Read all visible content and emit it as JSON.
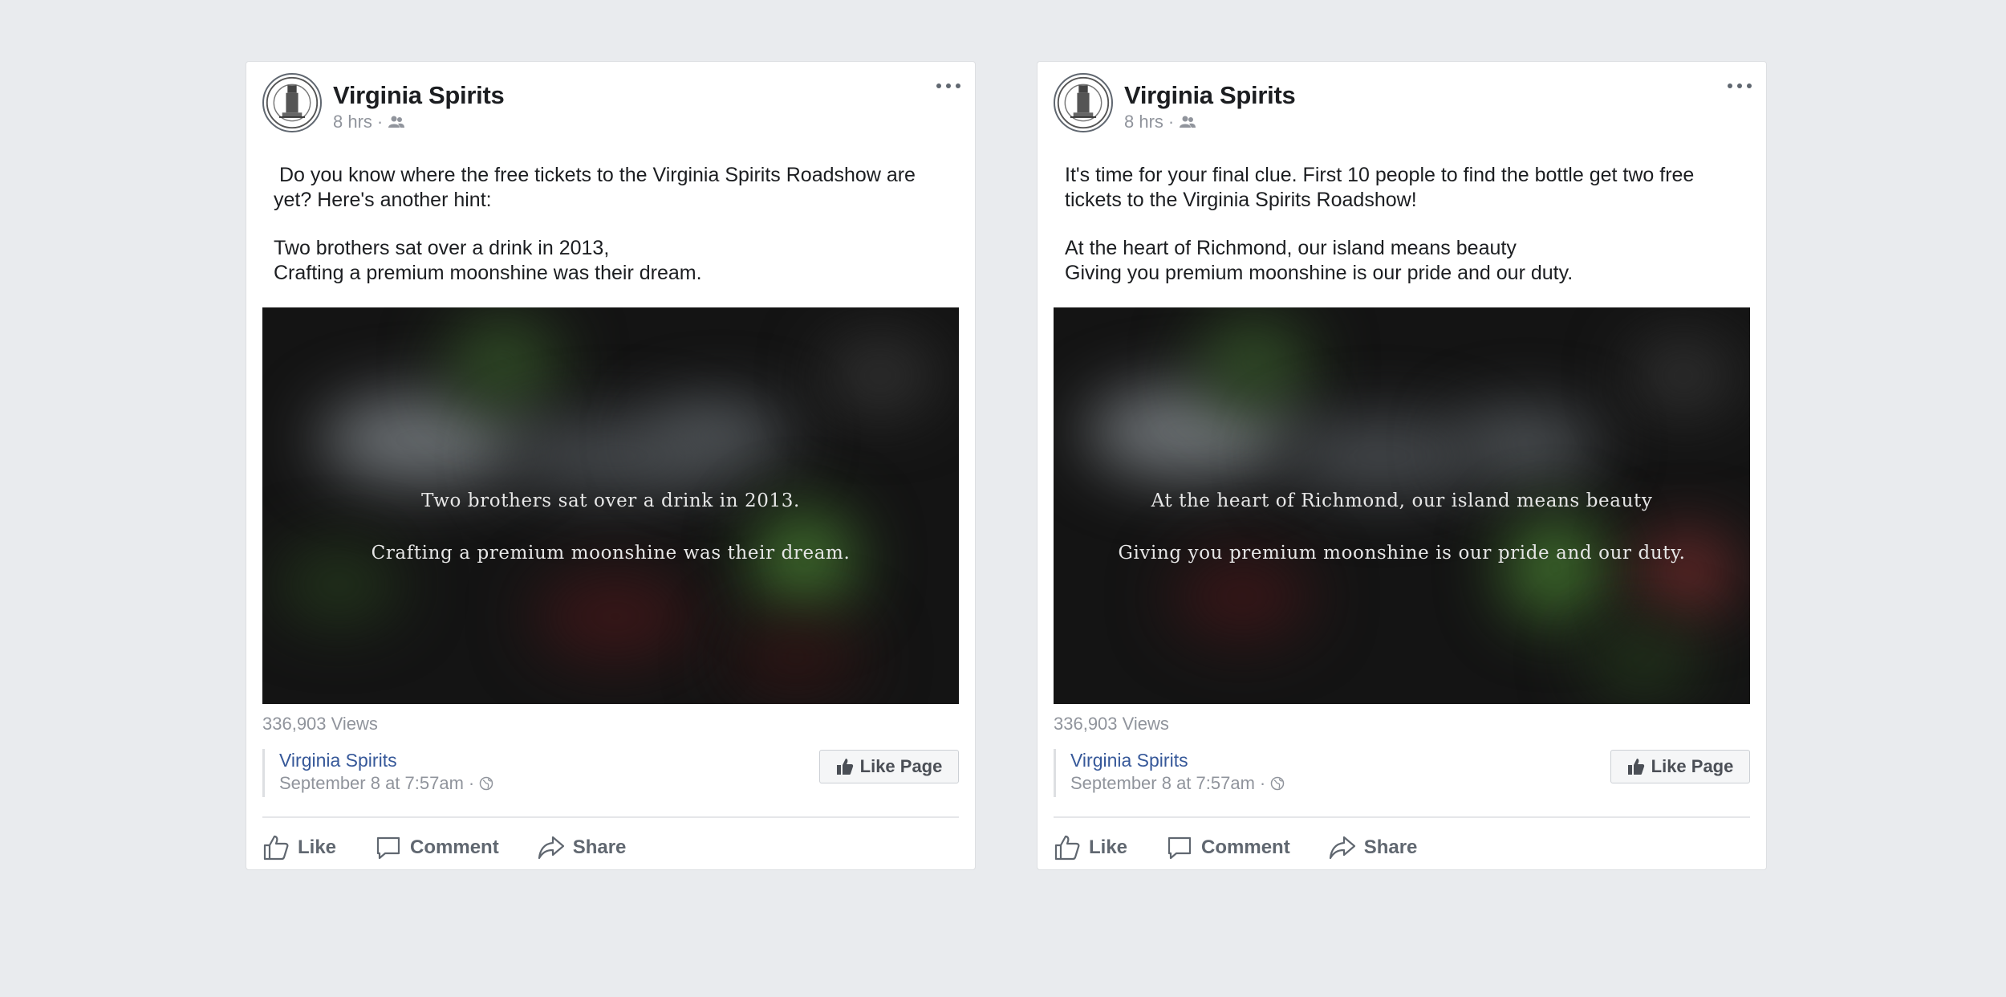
{
  "colors": {
    "background": "#e9ebee",
    "card": "#ffffff",
    "link": "#365899",
    "muted": "#90949c",
    "video_bg": "#141414"
  },
  "posts": [
    {
      "page_name": "Virginia Spirits",
      "time": "8 hrs",
      "dot": "·",
      "audience_icon": "friends-icon",
      "paragraphs": [
        " Do you know where the free tickets to the Virginia Spirits Roadshow are yet? Here's another hint:",
        "Two brothers sat over a drink in 2013,\nCrafting a premium moonshine was their dream."
      ],
      "video": {
        "caption_line1": "Two brothers sat over a drink in 2013.",
        "caption_line2": "Crafting a premium moonshine was their dream."
      },
      "views": "336,903 Views",
      "attribution": {
        "name": "Virginia Spirits",
        "date": "September 8 at 7:57am",
        "dot": "·",
        "privacy_icon": "globe-icon"
      },
      "like_page_label": "Like Page",
      "actions": {
        "like": "Like",
        "comment": "Comment",
        "share": "Share"
      }
    },
    {
      "page_name": "Virginia Spirits",
      "time": "8 hrs",
      "dot": "·",
      "audience_icon": "friends-icon",
      "paragraphs": [
        "It's time for your final clue. First 10 people to find the bottle get two free tickets to the Virginia Spirits Roadshow!",
        "At the heart of Richmond, our island means beauty\nGiving you premium moonshine is our pride and our duty."
      ],
      "video": {
        "caption_line1": "At the heart of Richmond, our island means beauty",
        "caption_line2": "Giving you premium moonshine is our pride and our duty."
      },
      "views": "336,903 Views",
      "attribution": {
        "name": "Virginia Spirits",
        "date": "September 8 at 7:57am",
        "dot": "·",
        "privacy_icon": "globe-icon"
      },
      "like_page_label": "Like Page",
      "actions": {
        "like": "Like",
        "comment": "Comment",
        "share": "Share"
      }
    }
  ]
}
